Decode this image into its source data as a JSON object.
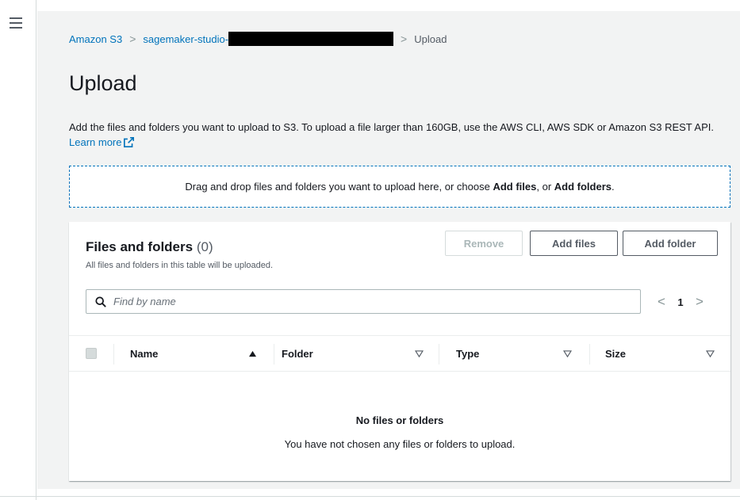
{
  "breadcrumb": {
    "root": "Amazon S3",
    "bucket": "sagemaker-studio-",
    "current": "Upload",
    "separator": ">"
  },
  "page": {
    "title": "Upload",
    "description": "Add the files and folders you want to upload to S3. To upload a file larger than 160GB, use the AWS CLI, AWS SDK or Amazon S3 REST API.",
    "learn_more": "Learn more"
  },
  "dropzone": {
    "text_before": "Drag and drop files and folders you want to upload here, or choose ",
    "add_files": "Add files",
    "text_middle": ", or ",
    "add_folders": "Add folders",
    "text_after": "."
  },
  "files_panel": {
    "title": "Files and folders",
    "count": "(0)",
    "subtitle": "All files and folders in this table will be uploaded.",
    "buttons": {
      "remove": "Remove",
      "add_files": "Add files",
      "add_folder": "Add folder"
    },
    "search": {
      "placeholder": "Find by name"
    },
    "pagination": {
      "prev": "<",
      "page": "1",
      "next": ">"
    },
    "columns": [
      {
        "label": "Name",
        "sort": "ascending"
      },
      {
        "label": "Folder",
        "sort": "none"
      },
      {
        "label": "Type",
        "sort": "none"
      },
      {
        "label": "Size",
        "sort": "none"
      }
    ],
    "empty": {
      "title": "No files or folders",
      "message": "You have not chosen any files or folders to upload."
    }
  },
  "colors": {
    "link": "#0073bb",
    "background": "#f2f3f3",
    "text": "#16191f"
  },
  "icons": {
    "menu": "hamburger-menu-icon",
    "external": "external-link-icon",
    "search": "search-icon"
  }
}
